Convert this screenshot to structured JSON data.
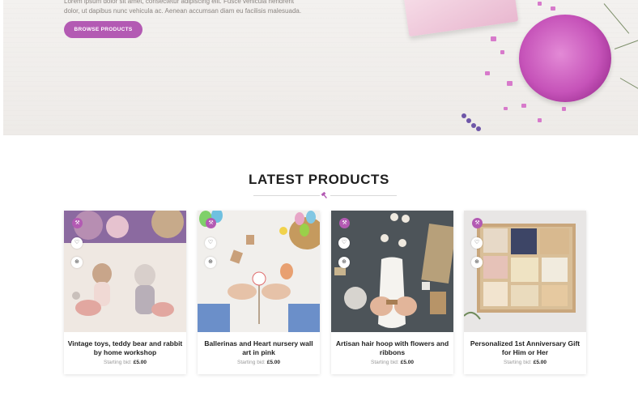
{
  "hero": {
    "text_line1": "Lorem ipsum dolor sit amet, consectetur adipiscing elit. Fusce vehicula hendrerit",
    "text_line2": "dolor, ut dapibus nunc vehicula ac. Aenean accumsan diam eu facilisis malesuada.",
    "browse_label": "BROWSE PRODUCTS"
  },
  "section": {
    "title": "LATEST PRODUCTS"
  },
  "colors": {
    "accent": "#b35ab3"
  },
  "products": [
    {
      "name": "Vintage toys, teddy bear and rabbit by home workshop",
      "bid_label": "Starting bid:",
      "price": "£5.00"
    },
    {
      "name": "Ballerinas and Heart nursery wall art in pink",
      "bid_label": "Starting bid:",
      "price": "£5.00"
    },
    {
      "name": "Artisan hair hoop with flowers and ribbons",
      "bid_label": "Starting bid:",
      "price": "£5.00"
    },
    {
      "name": "Personalized 1st Anniversary Gift for Him or Her",
      "bid_label": "Starting bid:",
      "price": "£5.00"
    }
  ],
  "icons": {
    "badge": "gavel-icon",
    "wishlist": "heart-icon",
    "zoom": "zoom-icon",
    "divider": "gavel-icon"
  }
}
